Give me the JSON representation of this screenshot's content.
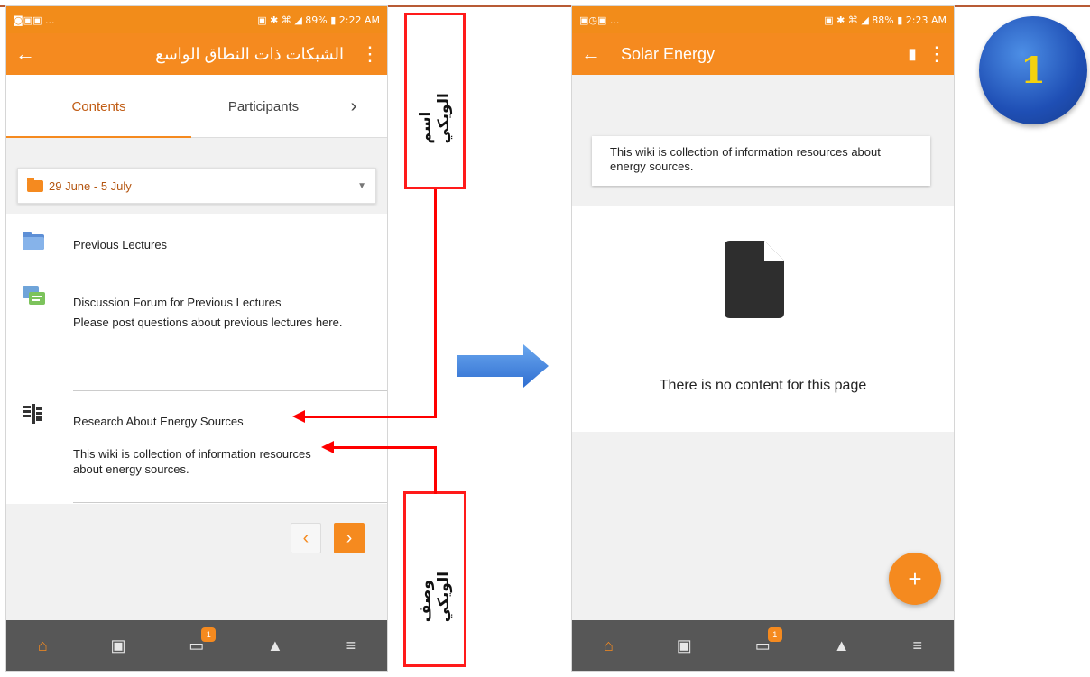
{
  "left": {
    "status": {
      "left": "◙▣▣ ...",
      "right": "▣ ✱ ⌘ ◢ 89% ▮ 2:22 AM"
    },
    "title": "الشبكات ذات النطاق الواسع",
    "tabs": [
      "Contents",
      "Participants"
    ],
    "tab_next": "›",
    "section": "29 June - 5 July",
    "items": [
      {
        "label": "Previous Lectures"
      },
      {
        "label": "Discussion Forum for Previous Lectures",
        "desc": "Please post questions about previous lectures here."
      },
      {
        "label": "Research About Energy Sources",
        "desc": "This wiki is collection of information resources about energy sources."
      }
    ],
    "prev": "‹",
    "next": "›",
    "badge": "1"
  },
  "right": {
    "status": {
      "left": "▣◷▣ ...",
      "right": "▣ ✱ ⌘ ◢ 88% ▮ 2:23 AM"
    },
    "title": "Solar Energy",
    "description": "This wiki is collection of information resources about energy sources.",
    "empty": "There is no content for this page",
    "fab": "+",
    "badge": "1"
  },
  "annotations": {
    "wiki_name": "اسم الويكي",
    "wiki_desc": "وصف الويكي",
    "step": "1"
  },
  "colors": {
    "accent": "#f58a1f",
    "arrow": "#ff0000",
    "bottom_bar": "#575757"
  }
}
